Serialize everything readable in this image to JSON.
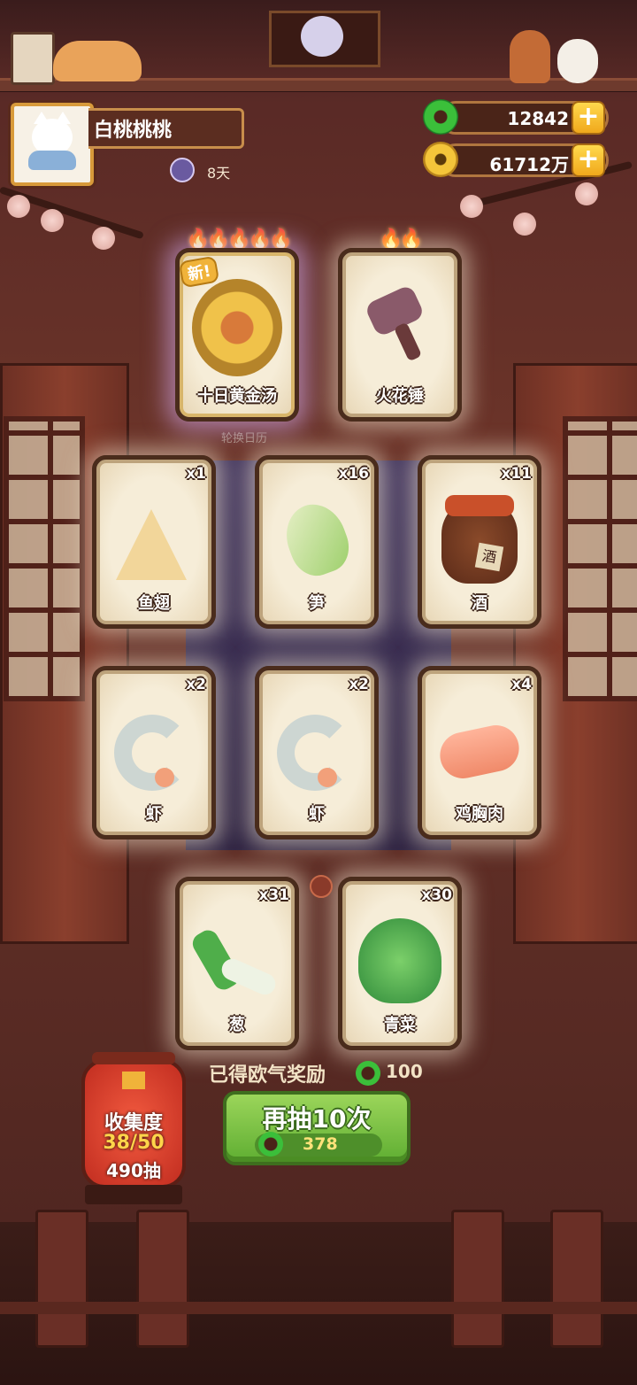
{
  "player": {
    "name": "白桃桃桃",
    "days": "8天"
  },
  "currencies": {
    "jade": {
      "value": "12842",
      "icon": "jade-icon"
    },
    "coins": {
      "value": "61712万",
      "icon": "coin-icon"
    }
  },
  "featured_cards": [
    {
      "label": "十日黄金汤",
      "flames": "🔥🔥🔥🔥🔥",
      "new_tag": "新!",
      "rarity": "legendary"
    },
    {
      "label": "火花锤",
      "flames": "🔥🔥",
      "rarity": "rare"
    }
  ],
  "background_caption": "轮换日历",
  "item_cards": [
    {
      "label": "鱼翅",
      "count": "x1",
      "icon": "shark-fin-icon"
    },
    {
      "label": "笋",
      "count": "x16",
      "icon": "bamboo-shoot-icon"
    },
    {
      "label": "酒",
      "count": "x11",
      "icon": "wine-jar-icon",
      "jar_text": "酒"
    },
    {
      "label": "虾",
      "count": "x2",
      "icon": "shrimp-icon"
    },
    {
      "label": "虾",
      "count": "x2",
      "icon": "shrimp-icon"
    },
    {
      "label": "鸡胸肉",
      "count": "x4",
      "icon": "chicken-breast-icon"
    },
    {
      "label": "葱",
      "count": "x31",
      "icon": "scallion-icon"
    },
    {
      "label": "青菜",
      "count": "x30",
      "icon": "bok-choy-icon"
    }
  ],
  "reward": {
    "text": "已得欧气奖励",
    "value": "100"
  },
  "draw_button": {
    "label": "再抽10次",
    "cost": "378"
  },
  "collection": {
    "title": "收集度",
    "progress": "38/50",
    "draws": "490抽"
  },
  "colors": {
    "jade": "#3bbf3a",
    "gold": "#f4c53a",
    "button_green": "#7cc547",
    "lantern_red": "#d63a2a"
  }
}
